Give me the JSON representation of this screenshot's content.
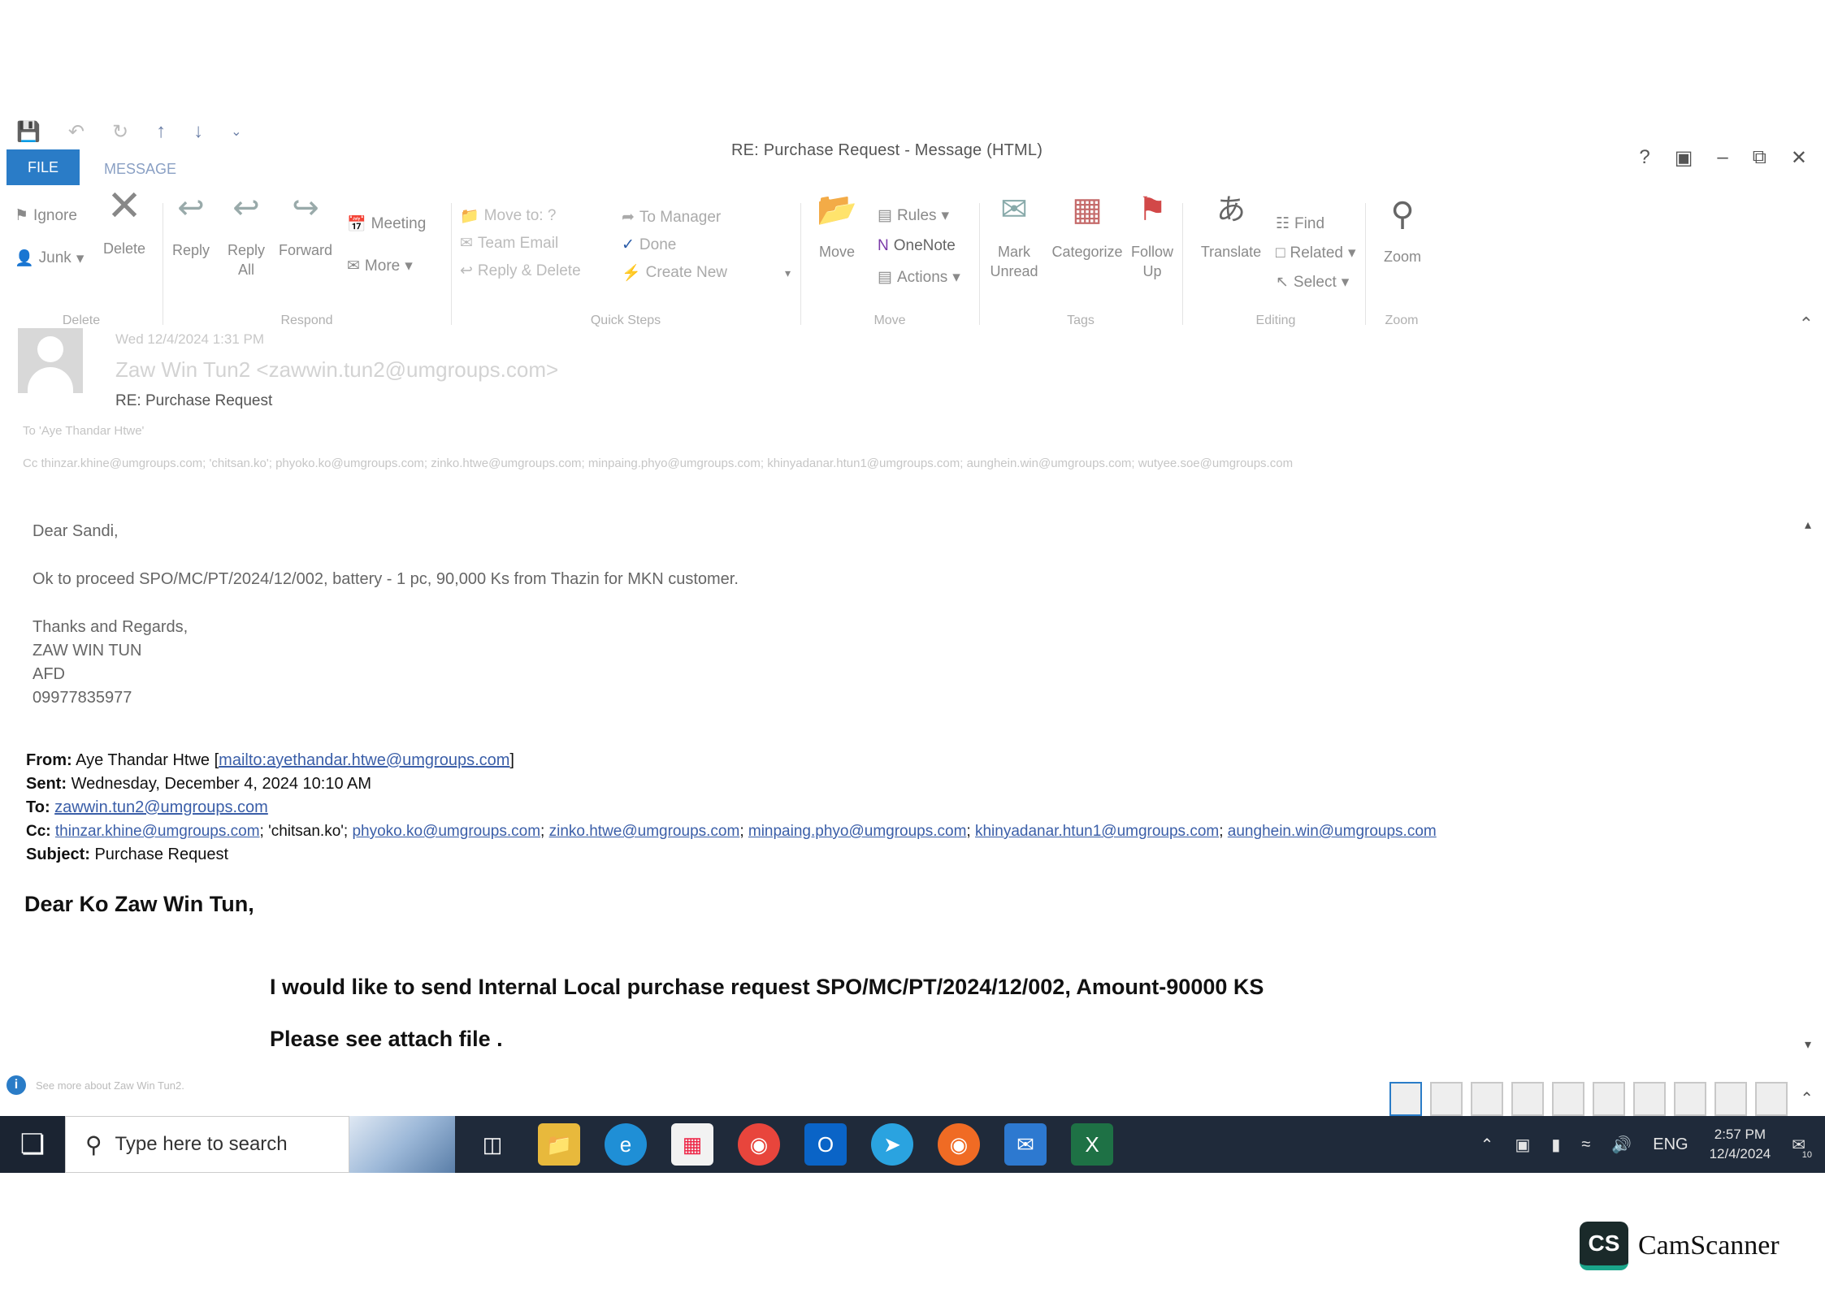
{
  "window": {
    "title": "RE: Purchase Request - Message (HTML)"
  },
  "tabs": {
    "file": "FILE",
    "message": "MESSAGE"
  },
  "ribbon": {
    "delete": {
      "ignore": "Ignore",
      "junk": "Junk",
      "delete": "Delete",
      "label": "Delete"
    },
    "respond": {
      "reply": "Reply",
      "reply_all": "Reply All",
      "forward": "Forward",
      "meeting": "Meeting",
      "more": "More",
      "label": "Respond"
    },
    "quick_steps": {
      "move_to": "Move to: ?",
      "team_email": "Team Email",
      "reply_delete": "Reply & Delete",
      "to_manager": "To Manager",
      "done": "Done",
      "create_new": "Create New",
      "label": "Quick Steps"
    },
    "move": {
      "move": "Move",
      "rules": "Rules",
      "onenote": "OneNote",
      "actions": "Actions",
      "label": "Move"
    },
    "tags": {
      "mark_unread": "Mark Unread",
      "categorize": "Categorize",
      "follow_up": "Follow Up",
      "label": "Tags"
    },
    "editing": {
      "translate": "Translate",
      "find": "Find",
      "related": "Related",
      "select": "Select",
      "label": "Editing"
    },
    "zoom": {
      "zoom": "Zoom",
      "label": "Zoom"
    }
  },
  "header": {
    "date": "Wed 12/4/2024 1:31 PM",
    "from": "Zaw Win Tun2 <zawwin.tun2@umgroups.com>",
    "subject": "RE: Purchase Request",
    "to": "To  'Aye Thandar Htwe'",
    "cc": "Cc  thinzar.khine@umgroups.com; 'chitsan.ko'; phyoko.ko@umgroups.com; zinko.htwe@umgroups.com; minpaing.phyo@umgroups.com; khinyadanar.htun1@umgroups.com; aunghein.win@umgroups.com; wutyee.soe@umgroups.com"
  },
  "reply": {
    "salutation": "Dear Sandi,",
    "text": "Ok to proceed SPO/MC/PT/2024/12/002, battery - 1 pc, 90,000 Ks from Thazin for MKN customer.",
    "closing": "Thanks and Regards,",
    "name": "ZAW WIN TUN",
    "dept": "AFD",
    "phone": "09977835977"
  },
  "original": {
    "from_label": "From:",
    "from_name": "Aye Thandar Htwe [",
    "from_link": "mailto:ayethandar.htwe@umgroups.com",
    "from_end": "]",
    "sent_label": "Sent:",
    "sent": "Wednesday, December 4, 2024 10:10 AM",
    "to_label": "To:",
    "to": "zawwin.tun2@umgroups.com",
    "cc_label": "Cc:",
    "cc1": "thinzar.khine@umgroups.com",
    "cc2": "; 'chitsan.ko'; ",
    "cc3": "phyoko.ko@umgroups.com",
    "cc4": "zinko.htwe@umgroups.com",
    "cc5": "minpaing.phyo@umgroups.com",
    "cc6": "khinyadanar.htun1@umgroups.com",
    "cc7": "aunghein.win@umgroups.com",
    "subject_label": "Subject:",
    "subject": "Purchase Request",
    "greeting": "Dear Ko Zaw Win Tun,",
    "line1": "I would like to send Internal  Local purchase request  SPO/MC/PT/2024/12/002, Amount-90000 KS",
    "line2": "Please see attach file ."
  },
  "infobar": {
    "text": "See more about Zaw Win Tun2."
  },
  "taskbar": {
    "search_placeholder": "Type here to search",
    "lang": "ENG",
    "time": "2:57 PM",
    "date": "12/4/2024",
    "notif_count": "10"
  },
  "watermark": {
    "badge": "CS",
    "name": "CamScanner"
  },
  "colors": {
    "accent": "#2a7cc7",
    "taskbar": "#1f2a3a",
    "link": "#3a5ea8"
  }
}
